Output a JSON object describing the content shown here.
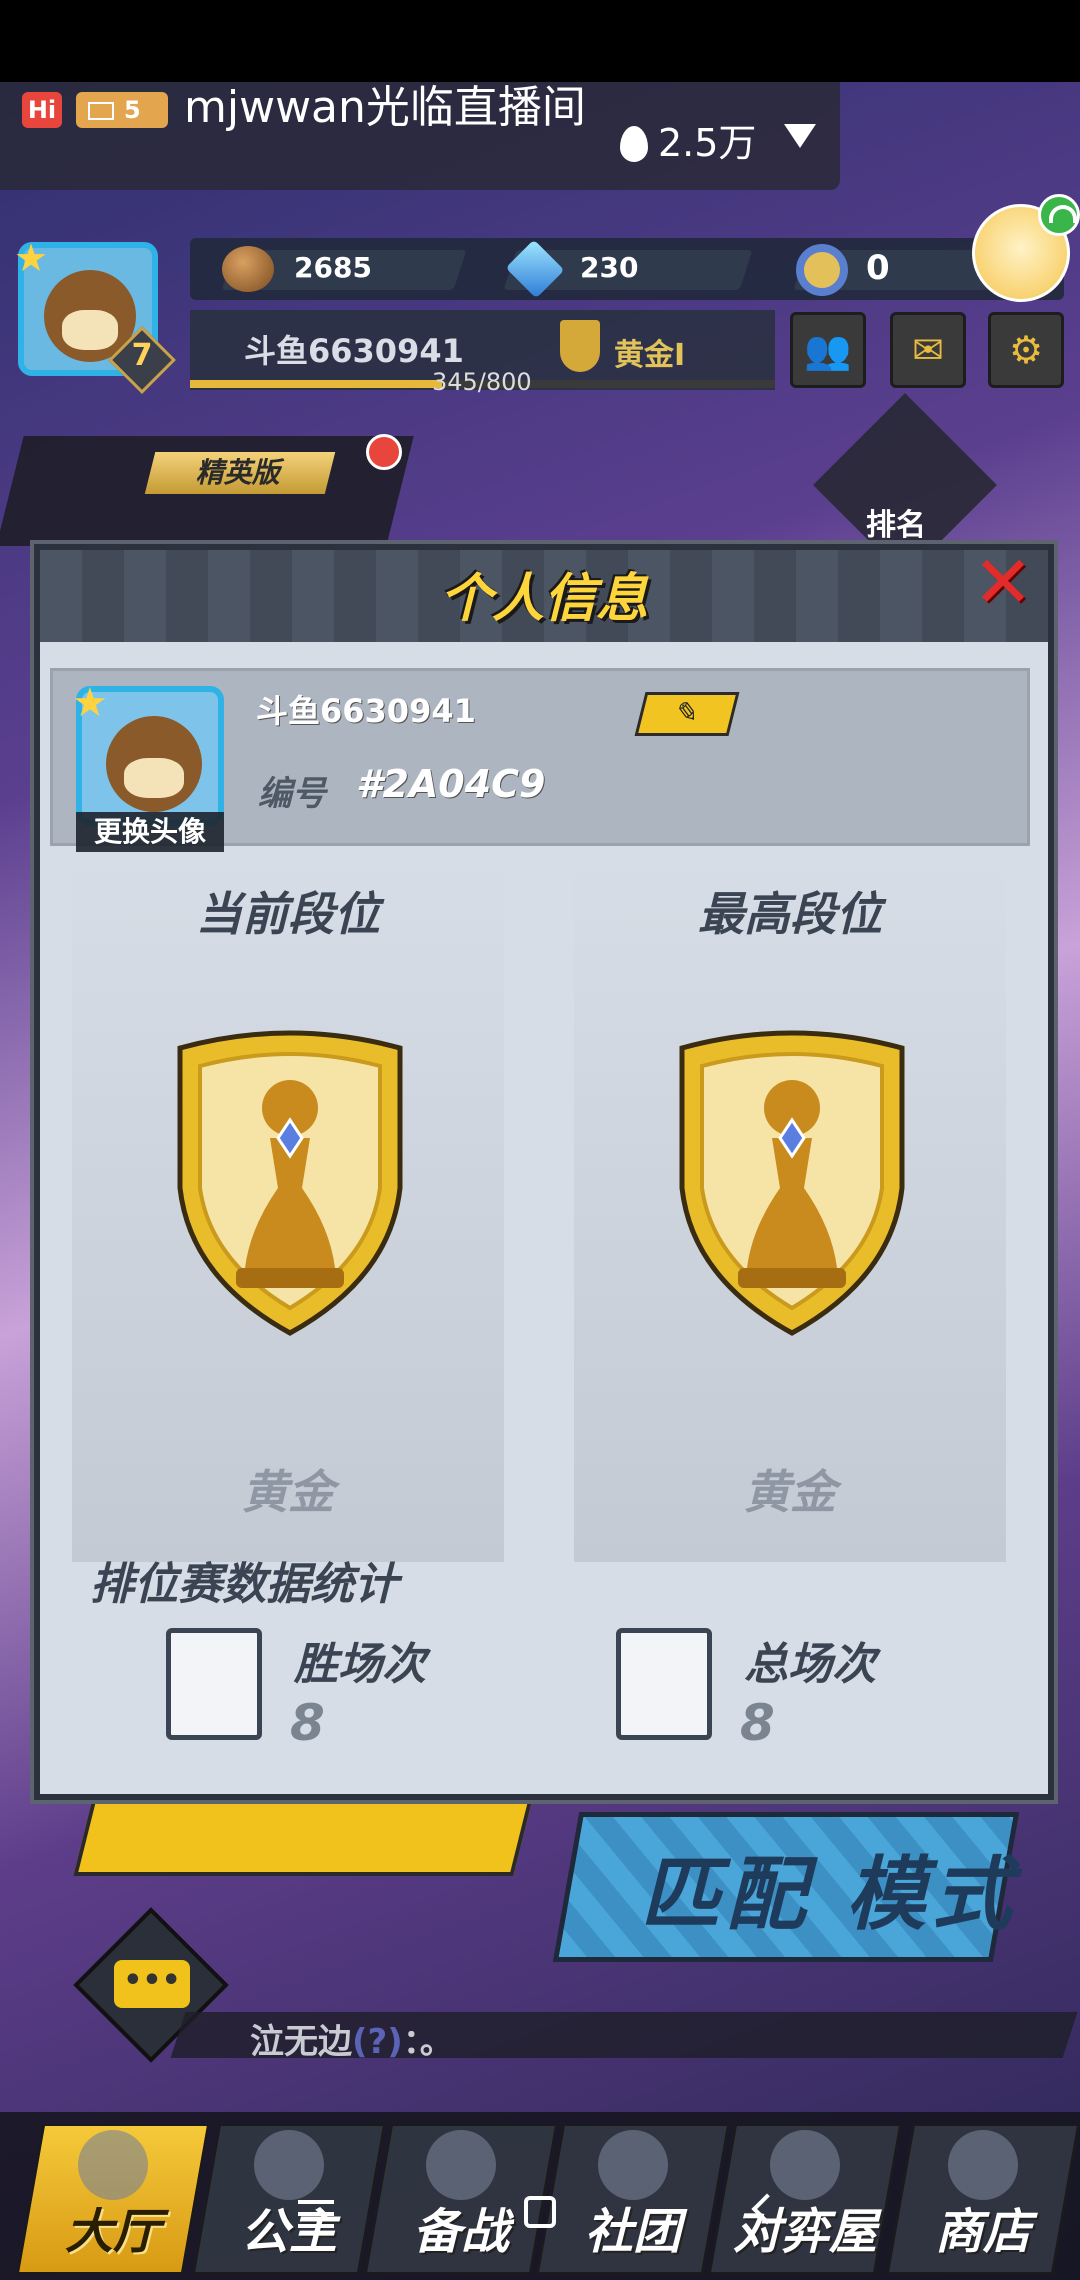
{
  "live": {
    "hi": "Hi",
    "level": "5",
    "room_name": "mjwwan光临直播间",
    "heat": "2.5万"
  },
  "player": {
    "level": "7",
    "name": "斗鱼6630941",
    "xp": "345/800",
    "xp_progress": 0.43,
    "rank_short": "黄金I"
  },
  "resources": {
    "coins": "2685",
    "gems": "230",
    "tokens": "0"
  },
  "side": {
    "elite_label": "精英版",
    "ranking_label": "排名"
  },
  "modal": {
    "title": "个人信息",
    "change_avatar": "更换头像",
    "name": "斗鱼6630941",
    "id_label": "编号",
    "id_value": "#2A04C9",
    "current_rank_title": "当前段位",
    "highest_rank_title": "最高段位",
    "current_rank": "黄金",
    "highest_rank": "黄金",
    "stats_title": "排位赛数据统计",
    "wins_label": "胜场次",
    "wins_value": "8",
    "total_label": "总场次",
    "total_value": "8"
  },
  "scene": {
    "match_mode": "匹配 模式",
    "chat_name": "泣无边",
    "chat_q": "(?)",
    "chat_msg": "：。"
  },
  "nav": {
    "items": [
      "大厅",
      "公主",
      "备战",
      "社团",
      "对弈屋",
      "商店"
    ]
  },
  "colors": {
    "accent_gold": "#f2c21c",
    "close_red": "#e22b2b",
    "title_yellow": "#ffd53c"
  }
}
